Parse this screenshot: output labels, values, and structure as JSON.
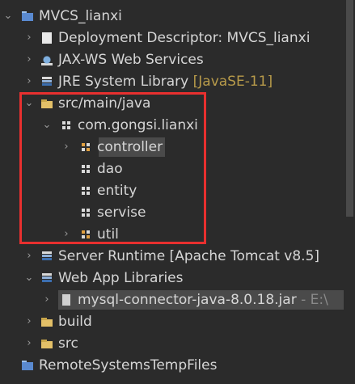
{
  "tree": {
    "project": {
      "label": "MVCS_lianxi"
    },
    "deployment_descriptor": {
      "label": "Deployment Descriptor: MVCS_lianxi"
    },
    "jax_ws": {
      "label": "JAX-WS Web Services"
    },
    "jre": {
      "label": "JRE System Library",
      "decoration": "[JavaSE-11]"
    },
    "src_main_java": {
      "label": "src/main/java"
    },
    "package": {
      "label": "com.gongsi.lianxi"
    },
    "subpackages": [
      {
        "label": "controller"
      },
      {
        "label": "dao"
      },
      {
        "label": "entity"
      },
      {
        "label": "servise"
      },
      {
        "label": "util"
      }
    ],
    "server_runtime": {
      "label": "Server Runtime [Apache Tomcat v8.5]"
    },
    "web_app_libraries": {
      "label": "Web App Libraries"
    },
    "mysql_jar": {
      "label": "mysql-connector-java-8.0.18.jar",
      "decoration": "- E:\\"
    },
    "build": {
      "label": "build"
    },
    "src": {
      "label": "src"
    },
    "remote": {
      "label": "RemoteSystemsTempFiles"
    }
  },
  "colors": {
    "background": "#2b2b2b",
    "highlight_frame": "#e8302f",
    "decoration": "#b89b4a"
  }
}
